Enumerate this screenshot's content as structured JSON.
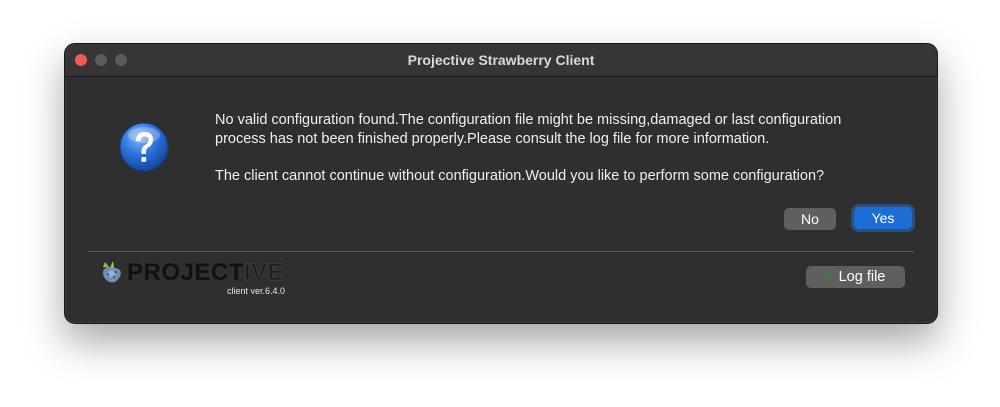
{
  "window": {
    "title": "Projective Strawberry Client"
  },
  "dialog": {
    "icon": "question-icon",
    "message_line1": "No valid configuration found.The configuration file might be missing,damaged or last configuration",
    "message_line2": "process has not been finished properly.Please consult the log file for more information.",
    "message_line3": "The client cannot continue without configuration.Would you like to perform some configuration?",
    "no_label": "No",
    "yes_label": "Yes"
  },
  "footer": {
    "logo_text_bold": "PROJECT",
    "logo_text_light": "IVE",
    "version": "client ver.6.4.0",
    "log_button_label": "Log file"
  },
  "colors": {
    "accent": "#1a6ed6",
    "close": "#ee5c55",
    "background": "#2f2f2f"
  }
}
